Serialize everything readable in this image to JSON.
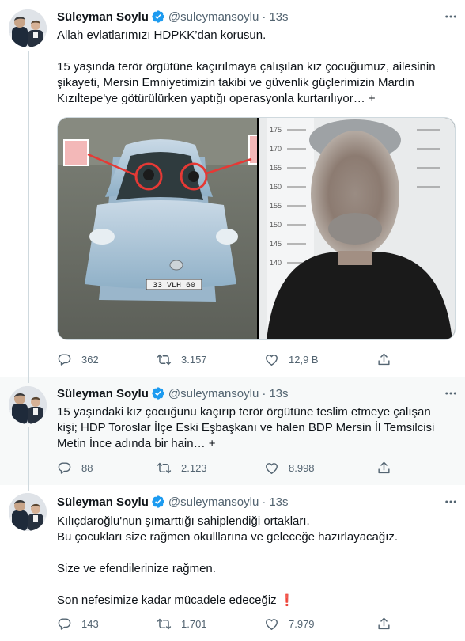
{
  "tweets": [
    {
      "name": "Süleyman Soylu",
      "handle": "@suleymansoylu",
      "dot": "·",
      "time": "13s",
      "paragraphs": [
        "Allah evlatlarımızı HDPKK’dan korusun.",
        "",
        "15 yaşında terör örgütüne kaçırılmaya çalışılan kız çocuğumuz, ailesinin şikayeti, Mersin Emniyetimizin takibi ve güvenlik güçlerimizin Mardin Kızıltepe'ye götürülürken yaptığı operasyonla kurtarılıyor… +"
      ],
      "media": {
        "plate": "33 VLH 60",
        "ruler_marks": [
          "175",
          "170",
          "165",
          "160",
          "155",
          "150",
          "145",
          "140"
        ]
      },
      "reply_count": "362",
      "retweet_count": "3.157",
      "like_count": "12,9 B"
    },
    {
      "name": "Süleyman Soylu",
      "handle": "@suleymansoylu",
      "dot": "·",
      "time": "13s",
      "paragraphs": [
        "15 yaşındaki kız çocuğunu kaçırıp terör örgütüne teslim etmeye çalışan kişi; HDP Toroslar İlçe Eski Eşbaşkanı ve halen BDP Mersin İl Temsilcisi Metin İnce adında bir hain… +"
      ],
      "reply_count": "88",
      "retweet_count": "2.123",
      "like_count": "8.998"
    },
    {
      "name": "Süleyman Soylu",
      "handle": "@suleymansoylu",
      "dot": "·",
      "time": "13s",
      "paragraphs": [
        "Kılıçdaroğlu'nun şımarttığı sahiplendiği ortakları.",
        "Bu çocukları size rağmen okulllarına ve geleceğe hazırlayacağız.",
        "",
        "Size ve efendilerinize rağmen.",
        "",
        "Son nefesimize kadar mücadele edeceğiz ❗"
      ],
      "reply_count": "143",
      "retweet_count": "1.701",
      "like_count": "7.979"
    }
  ],
  "icons": {
    "verified": "verified-badge-icon",
    "more": "more-icon",
    "reply": "reply-icon",
    "retweet": "retweet-icon",
    "like": "like-icon",
    "share": "share-icon"
  },
  "colors": {
    "verified_blue": "#1d9bf0",
    "secondary_text": "#536471",
    "thread_line": "#cfd9de",
    "hover_background": "#f7f9f9"
  }
}
